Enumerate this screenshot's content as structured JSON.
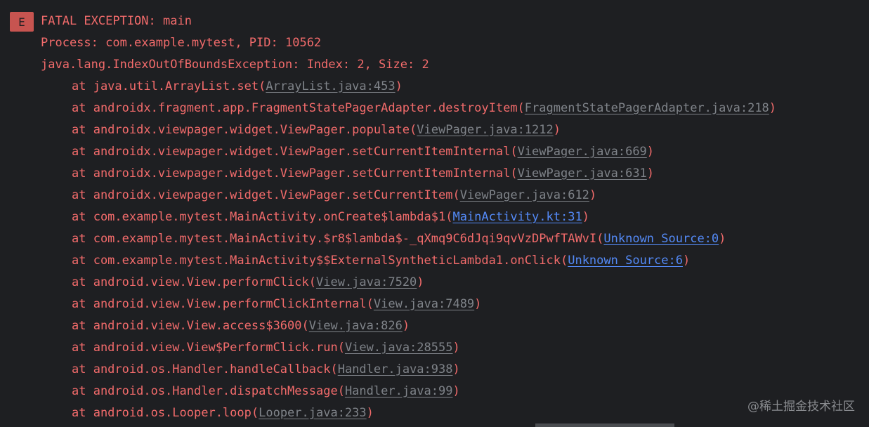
{
  "level_badge": "E",
  "header_lines": [
    "FATAL EXCEPTION: main",
    "Process: com.example.mytest, PID: 10562",
    "java.lang.IndexOutOfBoundsException: Index: 2, Size: 2"
  ],
  "frames": [
    {
      "text": "at java.util.ArrayList.set(",
      "link": "ArrayList.java:453",
      "kind": "lib"
    },
    {
      "text": "at androidx.fragment.app.FragmentStatePagerAdapter.destroyItem(",
      "link": "FragmentStatePagerAdapter.java:218",
      "kind": "lib"
    },
    {
      "text": "at androidx.viewpager.widget.ViewPager.populate(",
      "link": "ViewPager.java:1212",
      "kind": "lib"
    },
    {
      "text": "at androidx.viewpager.widget.ViewPager.setCurrentItemInternal(",
      "link": "ViewPager.java:669",
      "kind": "lib"
    },
    {
      "text": "at androidx.viewpager.widget.ViewPager.setCurrentItemInternal(",
      "link": "ViewPager.java:631",
      "kind": "lib"
    },
    {
      "text": "at androidx.viewpager.widget.ViewPager.setCurrentItem(",
      "link": "ViewPager.java:612",
      "kind": "lib"
    },
    {
      "text": "at com.example.mytest.MainActivity.onCreate$lambda$1(",
      "link": "MainActivity.kt:31",
      "kind": "user"
    },
    {
      "text": "at com.example.mytest.MainActivity.$r8$lambda$-_qXmq9C6dJqi9qvVzDPwfTAWvI(",
      "link": "Unknown Source:0",
      "kind": "user"
    },
    {
      "text": "at com.example.mytest.MainActivity$$ExternalSyntheticLambda1.onClick(",
      "link": "Unknown Source:6",
      "kind": "user"
    },
    {
      "text": "at android.view.View.performClick(",
      "link": "View.java:7520",
      "kind": "lib"
    },
    {
      "text": "at android.view.View.performClickInternal(",
      "link": "View.java:7489",
      "kind": "lib"
    },
    {
      "text": "at android.view.View.access$3600(",
      "link": "View.java:826",
      "kind": "lib"
    },
    {
      "text": "at android.view.View$PerformClick.run(",
      "link": "View.java:28555",
      "kind": "lib"
    },
    {
      "text": "at android.os.Handler.handleCallback(",
      "link": "Handler.java:938",
      "kind": "lib"
    },
    {
      "text": "at android.os.Handler.dispatchMessage(",
      "link": "Handler.java:99",
      "kind": "lib"
    },
    {
      "text": "at android.os.Looper.loop(",
      "link": "Looper.java:233",
      "kind": "lib"
    }
  ],
  "closing_paren": ")",
  "watermark": "@稀土掘金技术社区",
  "colors": {
    "background": "#1e1f22",
    "error_text": "#f26b6b",
    "badge_bg": "#c75450",
    "library_link": "#7f8389",
    "user_link": "#548af7"
  }
}
